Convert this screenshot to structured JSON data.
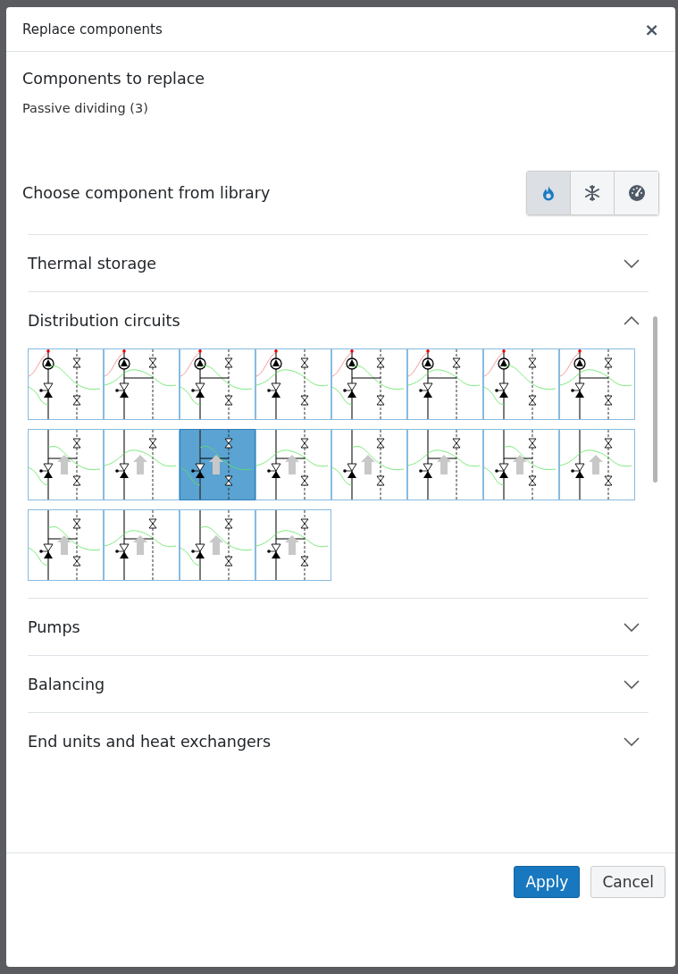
{
  "dialog": {
    "title": "Replace components",
    "close": "×"
  },
  "to_replace": {
    "heading": "Components to replace",
    "item": "Passive dividing (3)"
  },
  "library": {
    "heading": "Choose component from library",
    "modes": [
      {
        "kind": "heating",
        "selected": true
      },
      {
        "kind": "cooling",
        "selected": false
      },
      {
        "kind": "gauge",
        "selected": false
      }
    ]
  },
  "sections": [
    {
      "title": "Thermal storage",
      "expanded": false
    },
    {
      "title": "Distribution circuits",
      "expanded": true,
      "thumbnails": [
        {
          "selected": false
        },
        {
          "selected": false
        },
        {
          "selected": false
        },
        {
          "selected": false
        },
        {
          "selected": false
        },
        {
          "selected": false
        },
        {
          "selected": false
        },
        {
          "selected": false
        },
        {
          "selected": false
        },
        {
          "selected": false
        },
        {
          "selected": true
        },
        {
          "selected": false
        },
        {
          "selected": false
        },
        {
          "selected": false
        },
        {
          "selected": false
        },
        {
          "selected": false
        },
        {
          "selected": false
        },
        {
          "selected": false
        },
        {
          "selected": false
        },
        {
          "selected": false
        }
      ]
    },
    {
      "title": "Pumps",
      "expanded": false
    },
    {
      "title": "Balancing",
      "expanded": false
    },
    {
      "title": "End units and heat exchangers",
      "expanded": false
    }
  ],
  "buttons": [
    {
      "label": "Apply",
      "kind": "primary"
    },
    {
      "label": "Cancel",
      "kind": "secondary"
    }
  ]
}
